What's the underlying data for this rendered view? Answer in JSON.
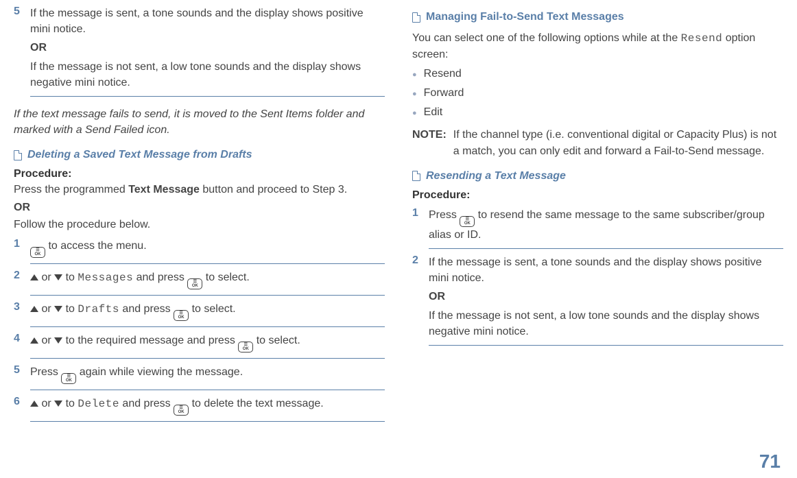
{
  "left": {
    "step5": {
      "num": "5",
      "line1": "If the message is sent, a tone sounds and the display shows positive mini notice.",
      "or": "OR",
      "line2": "If the message is not sent, a low tone sounds and the display shows negative mini notice."
    },
    "italic_note": "If the text message fails to send, it is moved to the Sent Items folder and marked with a Send Failed icon.",
    "heading": "Deleting a Saved Text Message from Drafts",
    "procedure_label": "Procedure:",
    "intro1a": "Press the programmed ",
    "intro1b": "Text Message",
    "intro1c": " button and proceed to Step 3.",
    "or": "OR",
    "intro2": "Follow the procedure below.",
    "s1": {
      "num": "1",
      "after": " to access the menu."
    },
    "s2": {
      "num": "2",
      "mid1": " or ",
      "mid2": " to ",
      "mono": "Messages",
      "mid3": " and press ",
      "after": " to select."
    },
    "s3": {
      "num": "3",
      "mid1": " or ",
      "mid2": " to ",
      "mono": "Drafts",
      "mid3": " and press ",
      "after": " to select."
    },
    "s4": {
      "num": "4",
      "mid1": " or ",
      "mid2": " to the required message and press ",
      "after": " to select."
    },
    "s5": {
      "num": "5",
      "pre": "Press ",
      "after": " again while viewing the message."
    },
    "s6": {
      "num": "6",
      "mid1": " or ",
      "mid2": " to ",
      "mono": "Delete",
      "mid3": " and press ",
      "after": " to delete the text message."
    }
  },
  "right": {
    "heading1": "Managing Fail-to-Send Text Messages",
    "intro_a": "You can select one of the following options while at the ",
    "intro_mono": "Resend",
    "intro_b": " option screen:",
    "bullets": [
      "Resend",
      "Forward",
      "Edit"
    ],
    "note_label": "NOTE:",
    "note_text": "If the channel type (i.e. conventional digital or Capacity Plus) is not a match, you can only edit and forward a Fail-to-Send message.",
    "heading2": "Resending a Text Message",
    "procedure_label": "Procedure:",
    "s1": {
      "num": "1",
      "pre": "Press ",
      "after": " to resend the same message to the same subscriber/group alias or ID."
    },
    "s2": {
      "num": "2",
      "line1": "If the message is sent, a tone sounds and the display shows positive mini notice.",
      "or": "OR",
      "line2": "If the message is not sent, a low tone sounds and the display shows negative mini notice."
    }
  },
  "page_number": "71"
}
